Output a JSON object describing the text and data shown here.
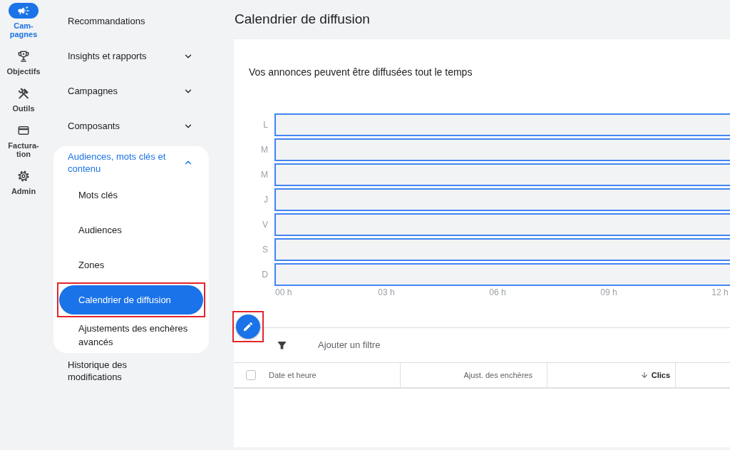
{
  "rail": [
    {
      "label": "Cam-\npagnes",
      "selected": true
    },
    {
      "label": "Objectifs",
      "selected": false
    },
    {
      "label": "Outils",
      "selected": false
    },
    {
      "label": "Factura-\ntion",
      "selected": false
    },
    {
      "label": "Admin",
      "selected": false
    }
  ],
  "nav": [
    {
      "kind": "link",
      "label": "Recommandations",
      "selected": false
    },
    {
      "kind": "group",
      "label": "Insights et rapports",
      "selected": false,
      "expanded": false
    },
    {
      "kind": "group",
      "label": "Campagnes",
      "selected": false,
      "expanded": false
    },
    {
      "kind": "group",
      "label": "Composants",
      "selected": false,
      "expanded": false
    },
    {
      "kind": "group",
      "label": "Audiences, mots clés et contenu",
      "selected": true,
      "expanded": true,
      "children": [
        {
          "label": "Mots clés",
          "selected": false,
          "highlighted": false
        },
        {
          "label": "Audiences",
          "selected": false,
          "highlighted": false
        },
        {
          "label": "Zones",
          "selected": false,
          "highlighted": false
        },
        {
          "label": "Calendrier de diffusion",
          "selected": true,
          "highlighted": true
        },
        {
          "label": "Ajustements des enchères avancés",
          "selected": false,
          "highlighted": false
        }
      ]
    },
    {
      "kind": "link",
      "label": "Historique des modifications",
      "selected": false
    }
  ],
  "page_title": "Calendrier de diffusion",
  "schedule": {
    "summary": "Vos annonces peuvent être diffusées tout le temps",
    "days": [
      "L",
      "M",
      "M",
      "J",
      "V",
      "S",
      "D"
    ],
    "hour_labels": [
      "00 h",
      "03 h",
      "06 h",
      "09 h",
      "12 h"
    ]
  },
  "edit_button": {
    "highlighted": true
  },
  "filter_bar": {
    "label": "Ajouter un filtre"
  },
  "table": {
    "select_all": {
      "checked": false
    },
    "columns": [
      {
        "kind": "text",
        "label": "Date et heure",
        "sorted": false
      },
      {
        "kind": "number",
        "label": "Ajust. des enchères",
        "sorted": false
      },
      {
        "kind": "number",
        "label": "Clics",
        "sorted": true
      }
    ]
  }
}
